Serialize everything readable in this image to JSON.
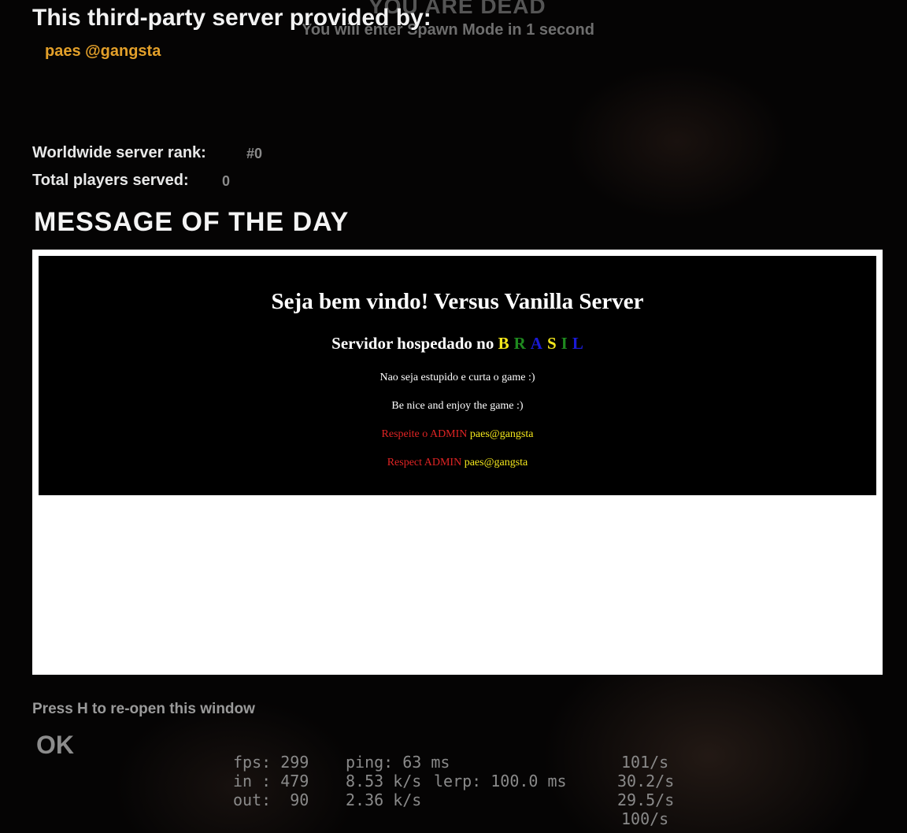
{
  "death_notice": {
    "title": "YOU ARE DEAD",
    "spawn_message": "You will enter Spawn Mode in 1 second"
  },
  "server_info": {
    "provided_by_label": "This third-party server provided by:",
    "provider_name": "paes @gangsta",
    "rank_label": "Worldwide server rank:",
    "rank_value": "#0",
    "players_label": "Total players served:",
    "players_value": "0"
  },
  "motd": {
    "heading": "MESSAGE OF THE DAY",
    "title": "Seja bem vindo! Versus Vanilla Server",
    "hosted_prefix": "Servidor hospedado no",
    "country_letters": [
      {
        "letter": "B",
        "color": "#f5e81c"
      },
      {
        "letter": "R",
        "color": "#1f8a1f"
      },
      {
        "letter": "A",
        "color": "#1a1ad6"
      },
      {
        "letter": "S",
        "color": "#f5e81c"
      },
      {
        "letter": "I",
        "color": "#1f8a1f"
      },
      {
        "letter": "L",
        "color": "#1a1ad6"
      }
    ],
    "line_pt": "Nao seja estupido e curta o game :)",
    "line_en": "Be nice and enjoy the game :)",
    "respect_pt": "Respeite o ADMIN",
    "respect_en": "Respect ADMIN",
    "admin_name": "paes@gangsta"
  },
  "footer": {
    "reopen_hint": "Press H to re-open this window",
    "ok_label": "OK"
  },
  "net_graph": {
    "fps": "fps: 299",
    "ping": "ping: 63 ms",
    "rate1": "101/s",
    "in": "in : 479",
    "in_kbs": "8.53 k/s",
    "lerp": "lerp: 100.0 ms",
    "rate2": "30.2/s",
    "out": "out:  90",
    "out_kbs": "2.36 k/s",
    "rate3": "29.5/s",
    "rate4": "100/s"
  }
}
